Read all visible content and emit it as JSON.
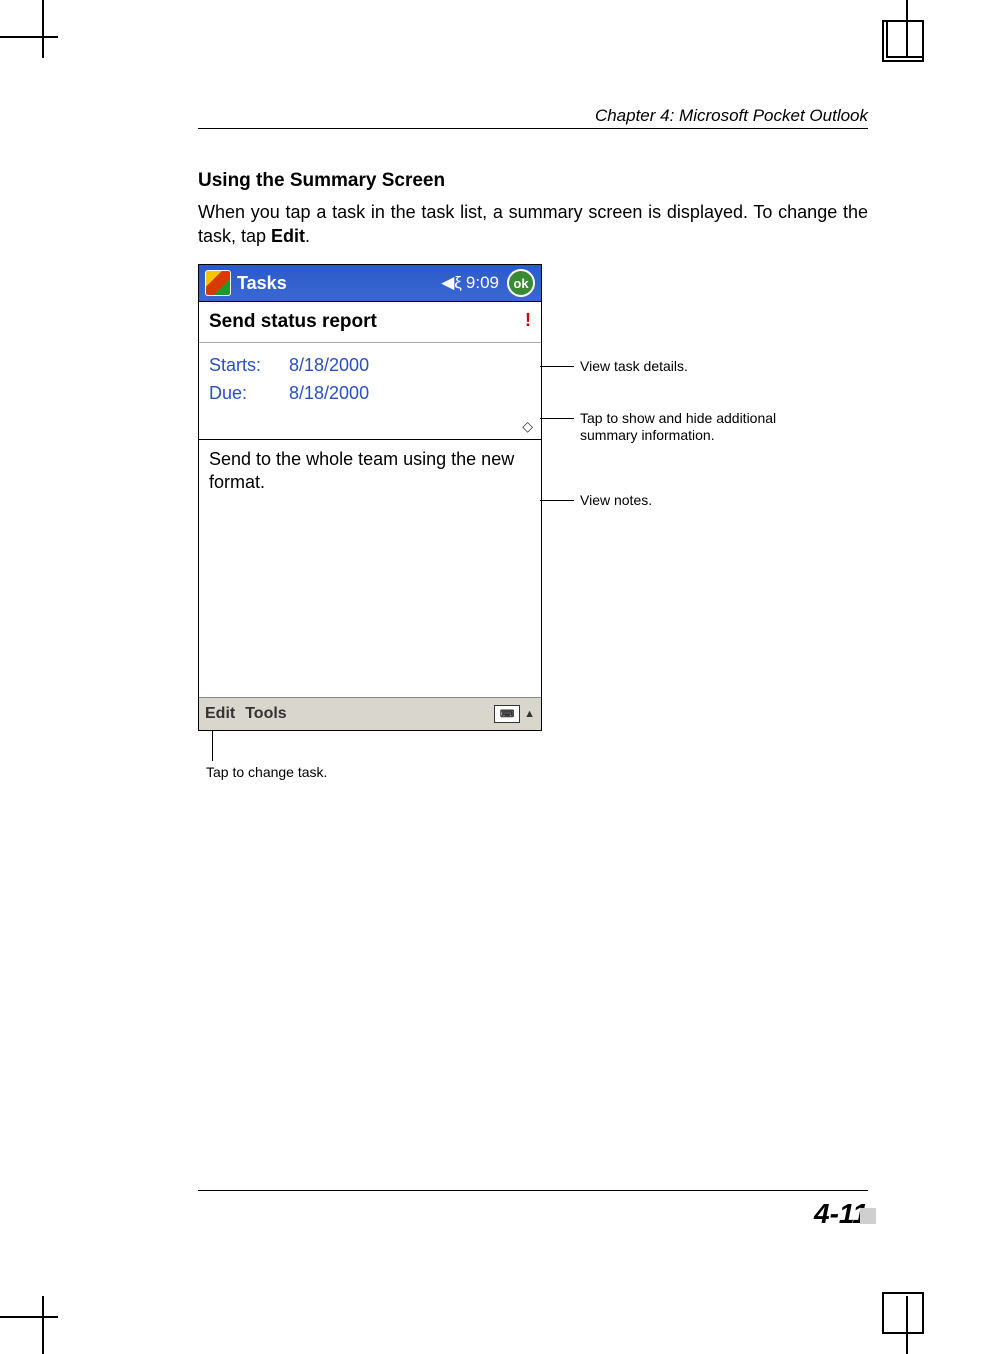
{
  "chapter_header": "Chapter 4: Microsoft Pocket Outlook",
  "section_heading": "Using the Summary Screen",
  "body_text": "When you tap a task in the task list, a summary screen is displayed. To change the task, tap ",
  "body_bold": "Edit",
  "body_after": ".",
  "titlebar": {
    "title": "Tasks",
    "time": "9:09",
    "ok": "ok"
  },
  "task": {
    "name": "Send status report",
    "starts_label": "Starts:",
    "starts_value": "8/18/2000",
    "due_label": "Due:",
    "due_value": "8/18/2000",
    "notes": "Send to the whole team using the new format."
  },
  "bottombar": {
    "edit": "Edit",
    "tools": "Tools"
  },
  "callouts": {
    "details": "View task details.",
    "toggle": "Tap to show and hide additional summary information.",
    "notes": "View notes.",
    "edit": "Tap to change task."
  },
  "page_number": "4-11"
}
